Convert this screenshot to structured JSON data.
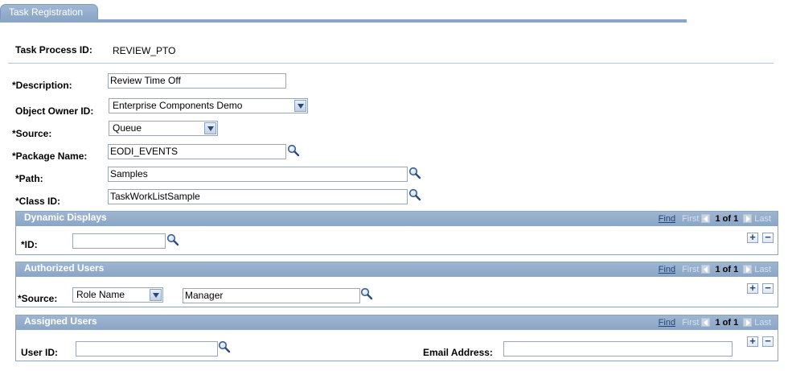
{
  "tab": {
    "label": "Task Registration"
  },
  "fields": {
    "task_process_id": {
      "label": "Task Process ID:",
      "value": "REVIEW_PTO"
    },
    "description": {
      "label": "*Description:",
      "value": "Review Time Off"
    },
    "object_owner": {
      "label": "Object Owner ID:",
      "value": "Enterprise Components Demo"
    },
    "source": {
      "label": "*Source:",
      "value": "Queue"
    },
    "package_name": {
      "label": "*Package Name:",
      "value": "EODI_EVENTS"
    },
    "path": {
      "label": "*Path:",
      "value": "Samples"
    },
    "class_id": {
      "label": "*Class ID:",
      "value": "TaskWorkListSample"
    }
  },
  "nav": {
    "find": "Find",
    "first": "First",
    "count": "1 of 1",
    "last": "Last"
  },
  "grids": {
    "dynamic_displays": {
      "title": "Dynamic Displays",
      "id_label": "*ID:",
      "id_value": ""
    },
    "authorized_users": {
      "title": "Authorized Users",
      "source_label": "*Source:",
      "source_value": "Role Name",
      "role_value": "Manager"
    },
    "assigned_users": {
      "title": "Assigned Users",
      "user_id_label": "User ID:",
      "user_id_value": "",
      "email_label": "Email Address:",
      "email_value": ""
    }
  },
  "buttons": {
    "add": "+",
    "remove": "−"
  },
  "colors": {
    "accent": "#8aa6c6",
    "link": "#24487a"
  }
}
